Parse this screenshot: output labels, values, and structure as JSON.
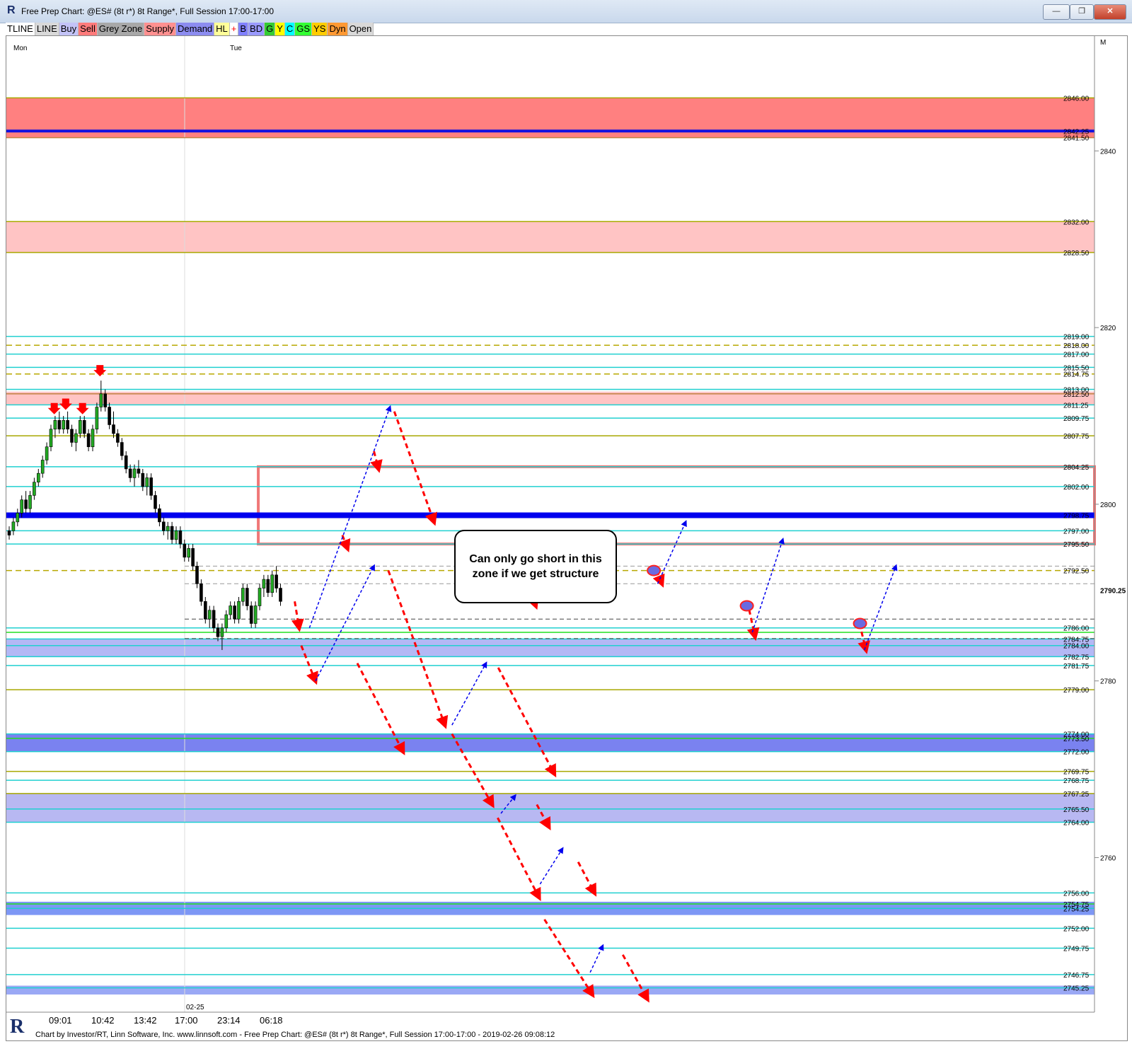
{
  "window": {
    "title": "Free Prep Chart: @ES# (8t r*) 8t Range*, Full Session 17:00-17:00",
    "buttons": [
      "—",
      "❐",
      "✕"
    ]
  },
  "toolbar": [
    {
      "label": "TLINE",
      "bg": "#ffffff"
    },
    {
      "label": "LINE",
      "bg": "#d9d9d9"
    },
    {
      "label": "Buy",
      "bg": "#c3c3f7"
    },
    {
      "label": "Sell",
      "bg": "#ff7b7b"
    },
    {
      "label": "Grey Zone",
      "bg": "#a8a8a8"
    },
    {
      "label": "Supply",
      "bg": "#ff9090"
    },
    {
      "label": "Demand",
      "bg": "#8c8cf0"
    },
    {
      "label": "HL",
      "bg": "#ffff99"
    },
    {
      "label": "+",
      "bg": "#ffffff",
      "color": "#ff0000"
    },
    {
      "label": "B",
      "bg": "#8080ff"
    },
    {
      "label": "BD",
      "bg": "#9999ff"
    },
    {
      "label": "G",
      "bg": "#33cc33"
    },
    {
      "label": "Y",
      "bg": "#ffff00"
    },
    {
      "label": "C",
      "bg": "#00ffff"
    },
    {
      "label": "GS",
      "bg": "#33ff33"
    },
    {
      "label": "YS",
      "bg": "#ffcc00"
    },
    {
      "label": "Dyn",
      "bg": "#ff9933"
    },
    {
      "label": "Open",
      "bg": "#d9d9d9"
    }
  ],
  "callout": {
    "line1": "Can only go short in this",
    "line2": "zone if we get structure"
  },
  "footer": "Chart by Investor/RT, Linn Software, Inc. www.linnsoft.com - Free Prep Chart: @ES# (8t r*) 8t Range*, Full Session 17:00-17:00 - 2019-02-26 09:08:12",
  "chart_data": {
    "type": "line",
    "title": "Free Prep Chart: @ES# (8t r*) 8t Range*, Full Session 17:00-17:00",
    "price_range": [
      2742.5,
      2853
    ],
    "axis_ticks": [
      2840,
      2820,
      2800,
      2780,
      2760
    ],
    "current_price": "2790.25",
    "top_date_labels": [
      "Mon",
      "Tue"
    ],
    "time_labels": [
      "09:01",
      "10:42",
      "13:42",
      "17:00",
      "23:14",
      "06:18"
    ],
    "date_label": "02-25",
    "axis_corner": "M",
    "zones": [
      {
        "from": 2841.5,
        "to": 2846.0,
        "color": "#ff8080"
      },
      {
        "from": 2828.5,
        "to": 2832.0,
        "color": "#ffc4c4"
      },
      {
        "from": 2811.25,
        "to": 2812.75,
        "color": "#ffc4c4"
      },
      {
        "from": 2782.75,
        "to": 2784.75,
        "color": "#b4b8f5"
      },
      {
        "from": 2772.0,
        "to": 2774.0,
        "color": "#7a82f0"
      },
      {
        "from": 2764.0,
        "to": 2767.25,
        "color": "#b8b8f2"
      },
      {
        "from": 2753.5,
        "to": 2755.0,
        "color": "#7d97f5"
      },
      {
        "from": 2744.5,
        "to": 2745.5,
        "color": "#9aa8f5"
      }
    ],
    "outline_zone": {
      "from": 2795.5,
      "to": 2804.25,
      "color": "#f07878"
    },
    "levels": [
      {
        "price": 2846.0,
        "label": "2846.00",
        "color": "#a8a800",
        "style": "solid"
      },
      {
        "price": 2842.25,
        "label": "2842.25",
        "color": "#1010e0",
        "style": "thick"
      },
      {
        "price": 2841.5,
        "label": "2841.50",
        "color": "#c08040",
        "style": "solid"
      },
      {
        "price": 2832.0,
        "label": "2832.00",
        "color": "#a8a800",
        "style": "solid"
      },
      {
        "price": 2828.5,
        "label": "2828.50",
        "color": "#a8a800",
        "style": "solid"
      },
      {
        "price": 2819.0,
        "label": "2819.00",
        "color": "#20d0d0",
        "style": "solid"
      },
      {
        "price": 2818.0,
        "label": "2818.00",
        "color": "#b8a800",
        "style": "dashed"
      },
      {
        "price": 2817.0,
        "label": "2817.00",
        "color": "#20d0d0",
        "style": "solid"
      },
      {
        "price": 2815.5,
        "label": "2815.50",
        "color": "#20d0d0",
        "style": "solid"
      },
      {
        "price": 2814.75,
        "label": "2814.75",
        "color": "#b8a800",
        "style": "dashed"
      },
      {
        "price": 2813.0,
        "label": "2813.00",
        "color": "#20d0d0",
        "style": "solid"
      },
      {
        "price": 2812.5,
        "label": "2812.50",
        "color": "#c08040",
        "style": "solid"
      },
      {
        "price": 2811.25,
        "label": "2811.25",
        "color": "#20d0d0",
        "style": "solid"
      },
      {
        "price": 2809.75,
        "label": "2809.75",
        "color": "#20d0d0",
        "style": "solid"
      },
      {
        "price": 2807.75,
        "label": "2807.75",
        "color": "#a8a800",
        "style": "solid"
      },
      {
        "price": 2804.25,
        "label": "2804.25",
        "color": "#20d0d0",
        "style": "solid"
      },
      {
        "price": 2802.0,
        "label": "2802.00",
        "color": "#20d0d0",
        "style": "solid"
      },
      {
        "price": 2798.75,
        "label": "2798.75",
        "color": "#0000ee",
        "style": "thick"
      },
      {
        "price": 2797.0,
        "label": "2797.00",
        "color": "#20d0d0",
        "style": "solid"
      },
      {
        "price": 2795.5,
        "label": "2795.50",
        "color": "#20d0d0",
        "style": "solid"
      },
      {
        "price": 2792.5,
        "label": "2792.50",
        "color": "#b8a800",
        "style": "dashed"
      },
      {
        "price": 2786.0,
        "label": "2786.00",
        "color": "#20d0d0",
        "style": "solid"
      },
      {
        "price": 2785.5,
        "label": "",
        "color": "#20e020",
        "style": "solid"
      },
      {
        "price": 2784.75,
        "label": "2784.75",
        "color": "#20d0d0",
        "style": "solid"
      },
      {
        "price": 2784.0,
        "label": "2784.00",
        "color": "#20d0d0",
        "style": "solid"
      },
      {
        "price": 2782.75,
        "label": "2782.75",
        "color": "#20d0d0",
        "style": "solid"
      },
      {
        "price": 2781.75,
        "label": "2781.75",
        "color": "#20d0d0",
        "style": "solid"
      },
      {
        "price": 2779.0,
        "label": "2779.00",
        "color": "#a8a800",
        "style": "solid"
      },
      {
        "price": 2774.0,
        "label": "2774.00",
        "color": "#20d0d0",
        "style": "solid"
      },
      {
        "price": 2773.5,
        "label": "2773.50",
        "color": "#20e020",
        "style": "solid"
      },
      {
        "price": 2772.0,
        "label": "2772.00",
        "color": "#20d0d0",
        "style": "solid"
      },
      {
        "price": 2769.75,
        "label": "2769.75",
        "color": "#a8a800",
        "style": "solid"
      },
      {
        "price": 2768.75,
        "label": "2768.75",
        "color": "#20d0d0",
        "style": "solid"
      },
      {
        "price": 2767.25,
        "label": "2767.25",
        "color": "#a8a800",
        "style": "solid"
      },
      {
        "price": 2765.5,
        "label": "2765.50",
        "color": "#20d0d0",
        "style": "solid"
      },
      {
        "price": 2764.0,
        "label": "2764.00",
        "color": "#20d0d0",
        "style": "solid"
      },
      {
        "price": 2756.0,
        "label": "2756.00",
        "color": "#20d0d0",
        "style": "solid"
      },
      {
        "price": 2754.75,
        "label": "2754.75",
        "color": "#20e020",
        "style": "solid"
      },
      {
        "price": 2754.25,
        "label": "2754.25",
        "color": "#20d0d0",
        "style": "solid"
      },
      {
        "price": 2752.0,
        "label": "2752.00",
        "color": "#20d0d0",
        "style": "solid"
      },
      {
        "price": 2749.75,
        "label": "2749.75",
        "color": "#20d0d0",
        "style": "solid"
      },
      {
        "price": 2746.75,
        "label": "2746.75",
        "color": "#20d0d0",
        "style": "solid"
      },
      {
        "price": 2745.25,
        "label": "2745.25",
        "color": "#20d0d0",
        "style": "solid"
      }
    ],
    "candles": [
      [
        2797,
        2797.5,
        2796,
        2796.5
      ],
      [
        2797,
        2798.5,
        2796.5,
        2798
      ],
      [
        2798,
        2799.5,
        2797.5,
        2799
      ],
      [
        2799,
        2801,
        2798.5,
        2800.5
      ],
      [
        2800.5,
        2801.5,
        2799,
        2799.5
      ],
      [
        2799.5,
        2801.5,
        2799,
        2801
      ],
      [
        2801,
        2803,
        2800.5,
        2802.5
      ],
      [
        2802.5,
        2804,
        2802,
        2803.5
      ],
      [
        2803.5,
        2805.5,
        2803,
        2805
      ],
      [
        2805,
        2807,
        2804.5,
        2806.5
      ],
      [
        2806.5,
        2809,
        2806,
        2808.5
      ],
      [
        2808.5,
        2810,
        2807.5,
        2809.5
      ],
      [
        2809.5,
        2810.5,
        2808,
        2808.5
      ],
      [
        2808.5,
        2810,
        2808,
        2809.5
      ],
      [
        2809.5,
        2810.5,
        2808,
        2808.5
      ],
      [
        2808.5,
        2809,
        2806.5,
        2807
      ],
      [
        2807,
        2808.5,
        2806,
        2808
      ],
      [
        2808,
        2810,
        2807.5,
        2809.5
      ],
      [
        2809.5,
        2810,
        2807.5,
        2808
      ],
      [
        2808,
        2808.5,
        2806,
        2806.5
      ],
      [
        2806.5,
        2809,
        2806,
        2808.5
      ],
      [
        2808.5,
        2811.5,
        2808,
        2811
      ],
      [
        2811,
        2814,
        2810.5,
        2812.5
      ],
      [
        2812.5,
        2813,
        2810.5,
        2811
      ],
      [
        2811,
        2811.5,
        2808.5,
        2809
      ],
      [
        2809,
        2810.5,
        2807.5,
        2808
      ],
      [
        2808,
        2808.5,
        2806.5,
        2807
      ],
      [
        2807,
        2807.5,
        2805,
        2805.5
      ],
      [
        2805.5,
        2806,
        2803.5,
        2804
      ],
      [
        2804,
        2804.5,
        2802.5,
        2803
      ],
      [
        2803,
        2804.5,
        2802,
        2804
      ],
      [
        2804,
        2805,
        2803,
        2803.5
      ],
      [
        2803.5,
        2804,
        2801.5,
        2802
      ],
      [
        2802,
        2803.5,
        2801,
        2803
      ],
      [
        2803,
        2803.5,
        2800.5,
        2801
      ],
      [
        2801,
        2801.5,
        2799,
        2799.5
      ],
      [
        2799.5,
        2800,
        2797.5,
        2798
      ],
      [
        2798,
        2798.5,
        2796.5,
        2797
      ],
      [
        2797,
        2798,
        2796,
        2797.5
      ],
      [
        2797.5,
        2798,
        2795.5,
        2796
      ],
      [
        2796,
        2797.5,
        2795.5,
        2797
      ],
      [
        2797,
        2797.5,
        2795,
        2795.5
      ],
      [
        2795.5,
        2796,
        2793.5,
        2794
      ],
      [
        2794,
        2795.5,
        2793.5,
        2795
      ],
      [
        2795,
        2795.5,
        2792.5,
        2793
      ],
      [
        2793,
        2793.5,
        2790.5,
        2791
      ],
      [
        2791,
        2791.5,
        2788.5,
        2789
      ],
      [
        2789,
        2789.5,
        2786.5,
        2787
      ],
      [
        2787,
        2788.5,
        2786,
        2788
      ],
      [
        2788,
        2788.5,
        2785.5,
        2786
      ],
      [
        2786,
        2786.5,
        2784.5,
        2785
      ],
      [
        2785,
        2786.5,
        2783.5,
        2786
      ],
      [
        2786,
        2788,
        2785.5,
        2787.5
      ],
      [
        2787.5,
        2789,
        2787,
        2788.5
      ],
      [
        2788.5,
        2789,
        2786.5,
        2787
      ],
      [
        2787,
        2789.5,
        2786.5,
        2789
      ],
      [
        2789,
        2791,
        2788.5,
        2790.5
      ],
      [
        2790.5,
        2791,
        2788,
        2788.5
      ],
      [
        2788.5,
        2789,
        2786,
        2786.5
      ],
      [
        2786.5,
        2789,
        2786,
        2788.5
      ],
      [
        2788.5,
        2791,
        2788,
        2790.5
      ],
      [
        2790.5,
        2792,
        2789.5,
        2791.5
      ],
      [
        2791.5,
        2792,
        2789.5,
        2790
      ],
      [
        2790,
        2792.5,
        2789.5,
        2792
      ],
      [
        2792,
        2793,
        2790,
        2790.5
      ],
      [
        2790.5,
        2791,
        2788.5,
        2789
      ]
    ],
    "trade_arrows_up": [
      {
        "from": [
          0.2785,
          2786.0
        ],
        "to": [
          0.3525,
          2811.0
        ]
      },
      {
        "from": [
          0.2842,
          2780.0
        ],
        "to": [
          0.3378,
          2793.0
        ]
      },
      {
        "from": [
          0.4095,
          2775.0
        ],
        "to": [
          0.4408,
          2782.0
        ]
      },
      {
        "from": [
          0.4545,
          2765.0
        ],
        "to": [
          0.4675,
          2767.0
        ]
      },
      {
        "from": [
          0.4905,
          2757.0
        ],
        "to": [
          0.511,
          2761.0
        ]
      },
      {
        "from": [
          0.5365,
          2747.0
        ],
        "to": [
          0.548,
          2750.0
        ]
      },
      {
        "from": [
          0.5985,
          2791.0
        ],
        "to": [
          0.6243,
          2798.0
        ]
      },
      {
        "from": [
          0.6855,
          2785.5
        ],
        "to": [
          0.7135,
          2796.0
        ]
      },
      {
        "from": [
          0.7885,
          2783.5
        ],
        "to": [
          0.8175,
          2793.0
        ]
      }
    ],
    "trade_arrows_down": [
      {
        "from": [
          0.3378,
          2806.0
        ],
        "to": [
          0.342,
          2804.0
        ]
      },
      {
        "from": [
          0.3565,
          2810.5
        ],
        "to": [
          0.393,
          2798.0
        ]
      },
      {
        "from": [
          0.3088,
          2796.5
        ],
        "to": [
          0.3135,
          2795.0
        ]
      },
      {
        "from": [
          0.265,
          2789.0
        ],
        "to": [
          0.269,
          2786.0
        ]
      },
      {
        "from": [
          0.271,
          2784.0
        ],
        "to": [
          0.284,
          2780.0
        ]
      },
      {
        "from": [
          0.351,
          2792.5
        ],
        "to": [
          0.403,
          2775.0
        ]
      },
      {
        "from": [
          0.3225,
          2782.0
        ],
        "to": [
          0.3645,
          2772.0
        ]
      },
      {
        "from": [
          0.452,
          2781.5
        ],
        "to": [
          0.5035,
          2769.5
        ]
      },
      {
        "from": [
          0.4095,
          2774.0
        ],
        "to": [
          0.4465,
          2766.0
        ]
      },
      {
        "from": [
          0.4875,
          2766.0
        ],
        "to": [
          0.4985,
          2763.5
        ]
      },
      {
        "from": [
          0.4515,
          2764.5
        ],
        "to": [
          0.4895,
          2755.5
        ]
      },
      {
        "from": [
          0.5255,
          2759.5
        ],
        "to": [
          0.5405,
          2756.0
        ]
      },
      {
        "from": [
          0.4945,
          2753.0
        ],
        "to": [
          0.5385,
          2744.5
        ]
      },
      {
        "from": [
          0.5665,
          2749.0
        ],
        "to": [
          0.589,
          2744.0
        ]
      },
      {
        "from": [
          0.4725,
          2793.0
        ],
        "to": [
          0.4865,
          2788.5
        ]
      },
      {
        "from": [
          0.5975,
          2792.5
        ],
        "to": [
          0.6025,
          2791.0
        ]
      },
      {
        "from": [
          0.681,
          2789.0
        ],
        "to": [
          0.688,
          2785.0
        ]
      },
      {
        "from": [
          0.784,
          2786.5
        ],
        "to": [
          0.79,
          2783.5
        ]
      }
    ],
    "circles": [
      [
        0.462,
        2790.5
      ],
      [
        0.595,
        2792.5
      ],
      [
        0.6805,
        2788.5
      ],
      [
        0.7845,
        2786.5
      ]
    ],
    "sell_signals": [
      [
        0.044,
        2810.5
      ],
      [
        0.0545,
        2811.0
      ],
      [
        0.07,
        2810.5
      ],
      [
        0.086,
        2814.8
      ]
    ]
  }
}
